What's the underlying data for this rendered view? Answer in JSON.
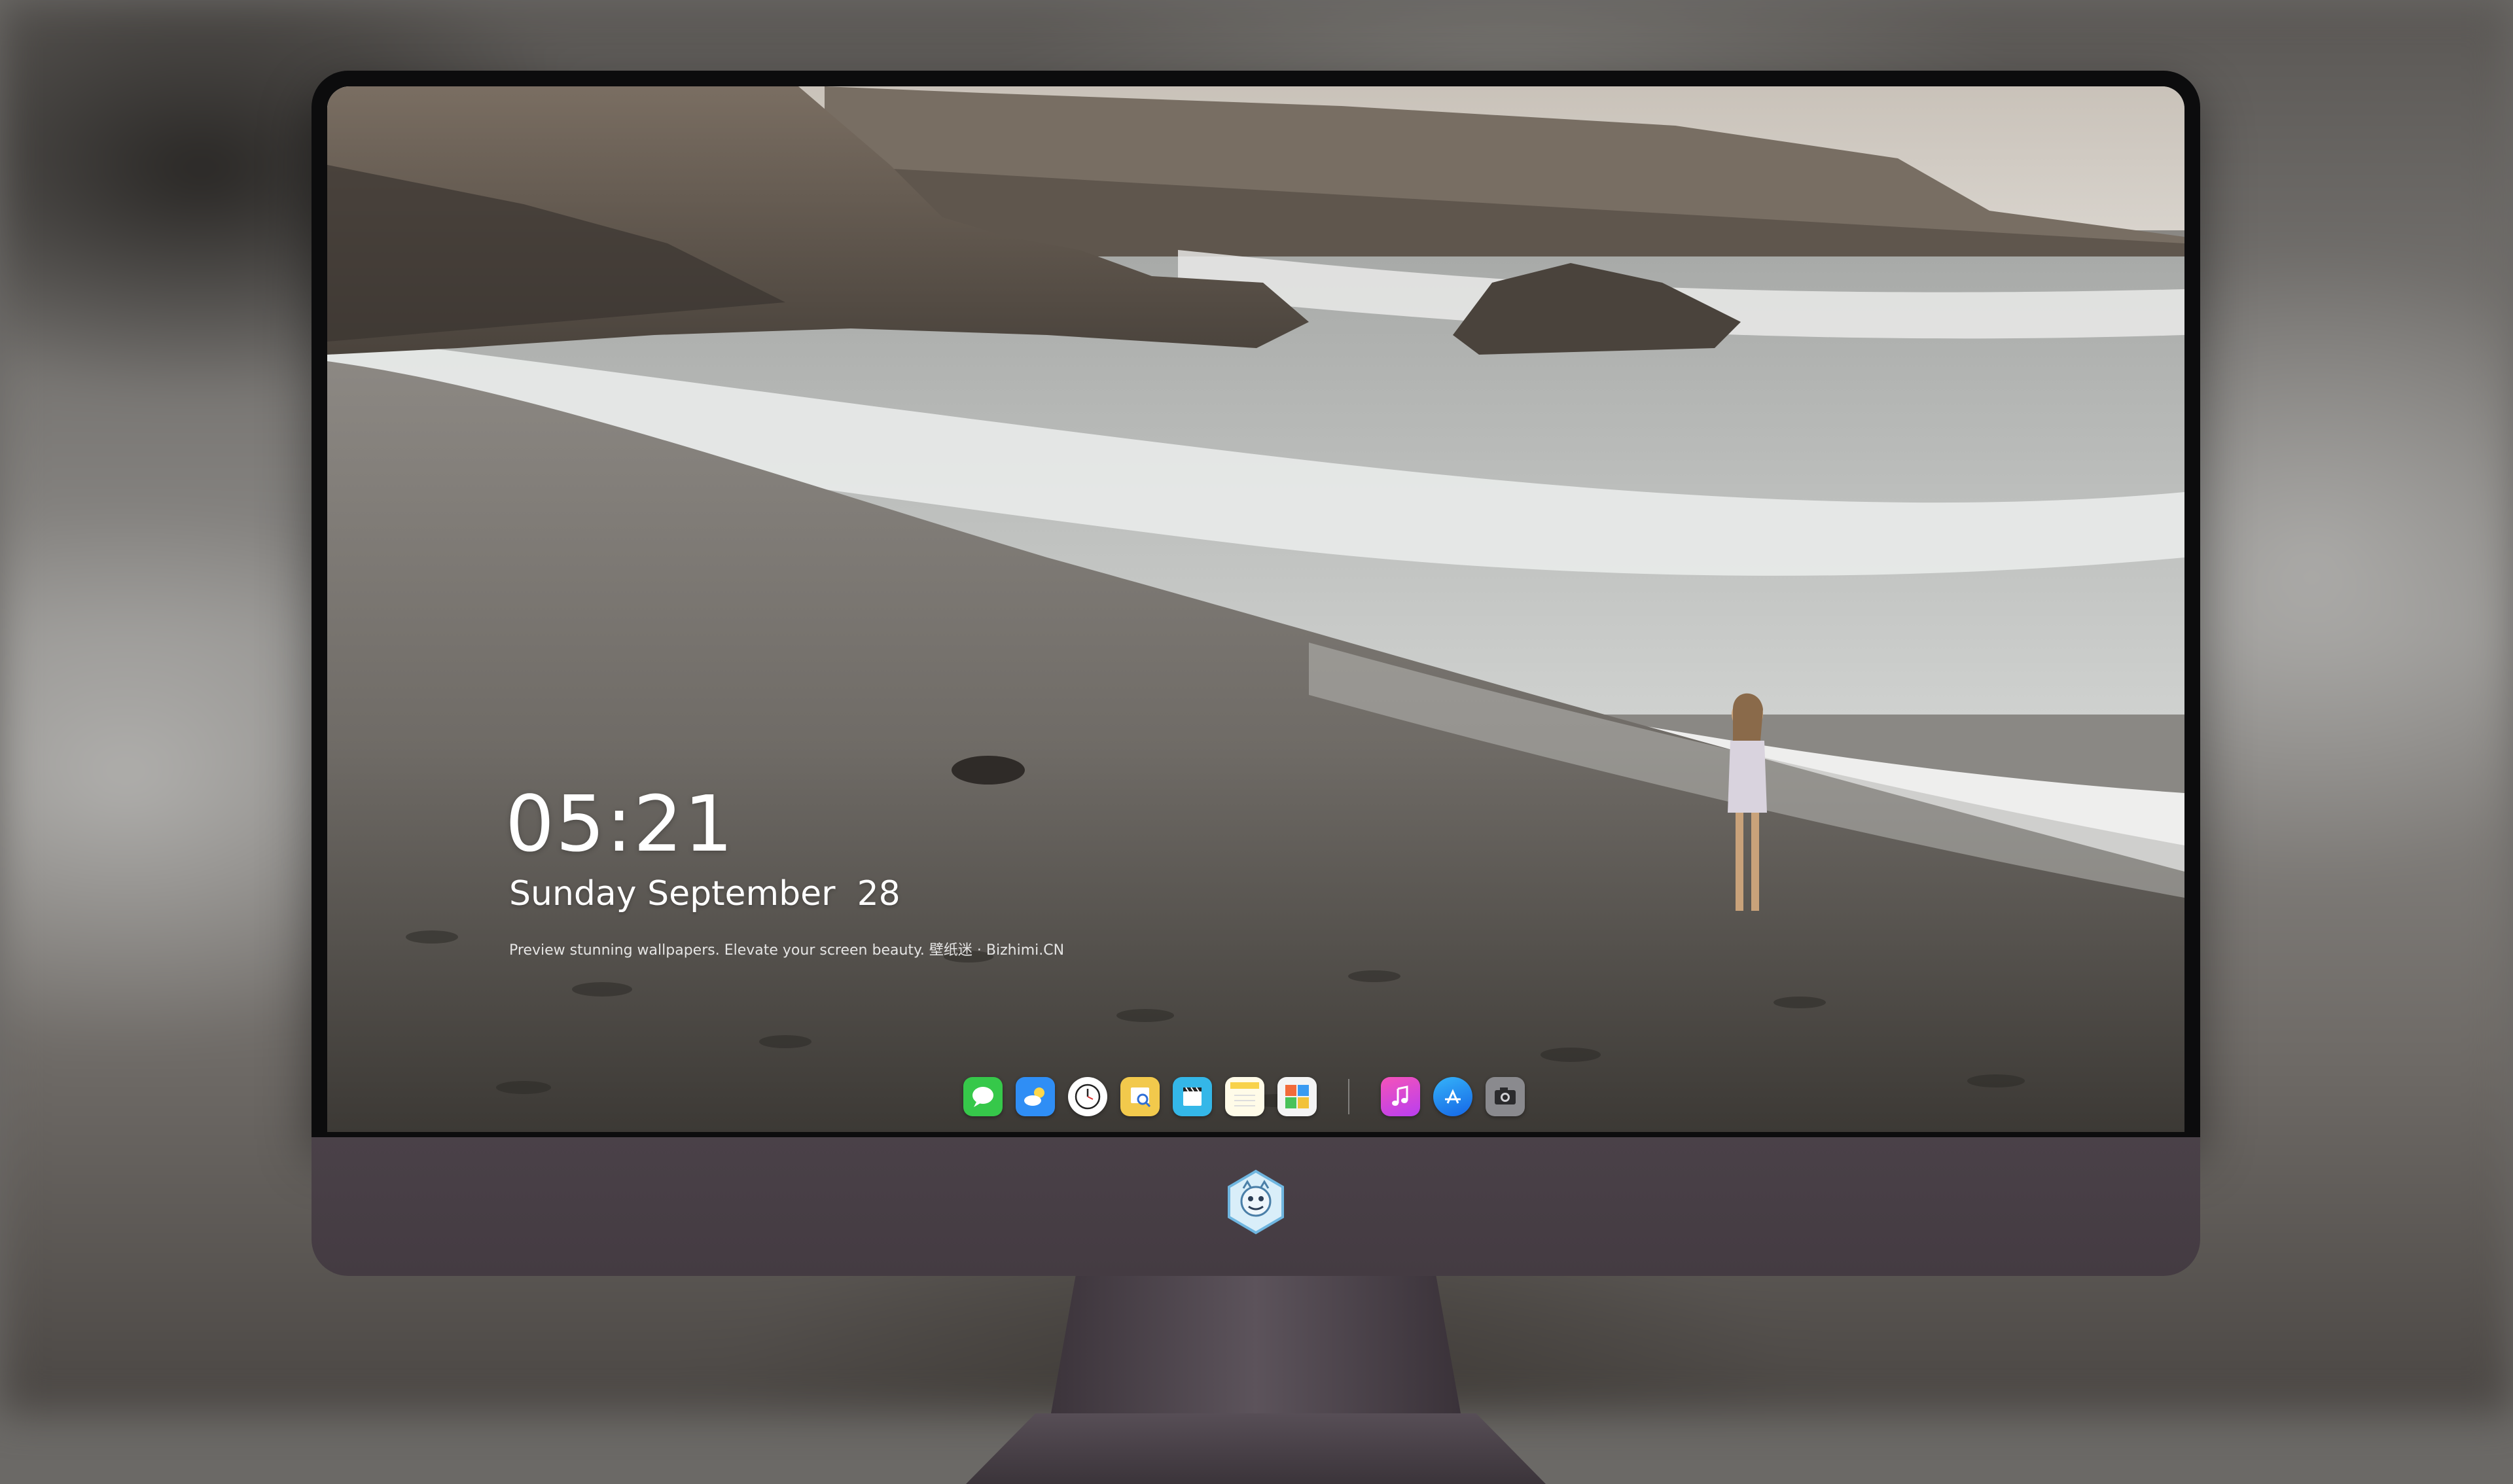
{
  "lockscreen": {
    "time": "05:21",
    "date": "Sunday September  28",
    "tagline": "Preview stunning wallpapers. Elevate your screen beauty. 壁纸迷 · Bizhimi.CN"
  },
  "dock": {
    "apps": [
      {
        "name": "messages-icon",
        "color": "#36c84a"
      },
      {
        "name": "weather-icon",
        "color": "#2f8ef5"
      },
      {
        "name": "clock-icon",
        "color": "#ffffff"
      },
      {
        "name": "preview-icon",
        "color": "#f2c94c"
      },
      {
        "name": "clips-icon",
        "color": "#34b7e8"
      },
      {
        "name": "notes-icon",
        "color": "#f8d24a"
      },
      {
        "name": "photo-booth-icon",
        "color": "#f26b3a"
      },
      {
        "name": "music-icon",
        "color": "#e944c9"
      },
      {
        "name": "app-store-icon",
        "color": "#1f8bf2"
      },
      {
        "name": "camera-icon",
        "color": "#8a8a8e"
      }
    ]
  },
  "monitor": {
    "logo": "dragon-logo-icon"
  }
}
